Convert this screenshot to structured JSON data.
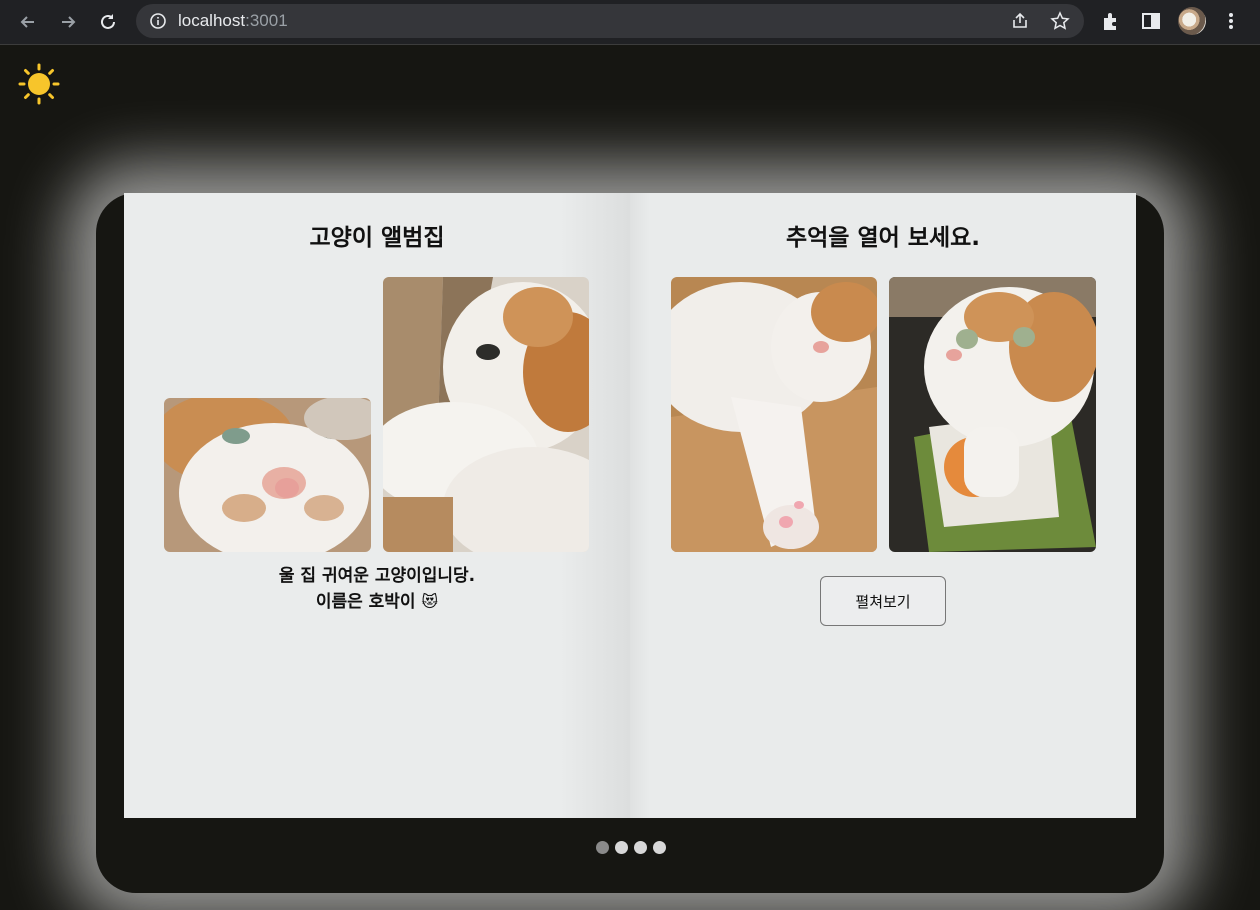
{
  "browser": {
    "url_host": "localhost",
    "url_port": ":3001",
    "icons": [
      "back-arrow-icon",
      "forward-arrow-icon",
      "reload-icon",
      "site-info-icon",
      "share-icon",
      "bookmark-star-icon",
      "extensions-icon",
      "side-panel-icon",
      "profile-avatar",
      "more-menu-icon"
    ]
  },
  "theme_toggle": {
    "icon": "sun-icon",
    "color": "#f7c52b"
  },
  "album": {
    "left_page": {
      "title": "고양이 앨범집",
      "caption_line1": "울 집 귀여운 고양이입니당.",
      "caption_line2": "이름은 호박이",
      "caption_emoji": "😻"
    },
    "right_page": {
      "title": "추억을 열어 보세요.",
      "button_label": "펼쳐보기"
    }
  },
  "pagination": {
    "total": 4,
    "active": 1
  }
}
